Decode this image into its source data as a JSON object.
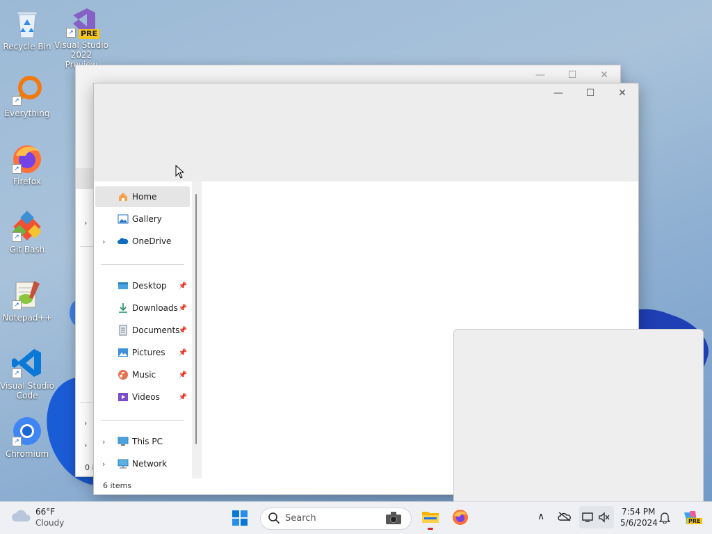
{
  "desktop": {
    "icons": [
      {
        "label": "Recycle Bin"
      },
      {
        "label": "Visual Studio 2022 Preview",
        "badge": "PRE"
      },
      {
        "label": "Everything"
      },
      {
        "label": "Firefox"
      },
      {
        "label": "Git Bash"
      },
      {
        "label": "Notepad++"
      },
      {
        "label": "Visual Studio Code"
      },
      {
        "label": "Chromium"
      }
    ]
  },
  "back_window": {
    "caption": {
      "minimize": "—",
      "maximize": "☐",
      "close": "✕"
    },
    "status_fragment": "0 i"
  },
  "explorer": {
    "caption": {
      "minimize": "—",
      "maximize": "☐",
      "close": "✕"
    },
    "nav": [
      {
        "label": "Home",
        "icon": "home-icon",
        "selected": true
      },
      {
        "label": "Gallery",
        "icon": "gallery-icon"
      },
      {
        "label": "OneDrive",
        "icon": "cloud-icon",
        "expandable": true
      },
      {
        "label": "Desktop",
        "icon": "desktop-folder-icon",
        "pinned": true
      },
      {
        "label": "Downloads",
        "icon": "download-icon",
        "pinned": true
      },
      {
        "label": "Documents",
        "icon": "documents-icon",
        "pinned": true
      },
      {
        "label": "Pictures",
        "icon": "pictures-icon",
        "pinned": true
      },
      {
        "label": "Music",
        "icon": "music-icon",
        "pinned": true
      },
      {
        "label": "Videos",
        "icon": "videos-icon",
        "pinned": true
      },
      {
        "label": "This PC",
        "icon": "computer-icon",
        "expandable": true
      },
      {
        "label": "Network",
        "icon": "network-icon",
        "expandable": true
      }
    ],
    "status": "6 items"
  },
  "taskbar": {
    "weather": {
      "temp": "66°F",
      "desc": "Cloudy"
    },
    "search_placeholder": "Search",
    "clock": {
      "time": "7:54 PM",
      "date": "5/6/2024"
    },
    "copilot_badge": "PRE"
  },
  "colors": {
    "accent": "#0067c0",
    "selection": "#e5e5e5",
    "taskbar": "#eef0f4"
  }
}
